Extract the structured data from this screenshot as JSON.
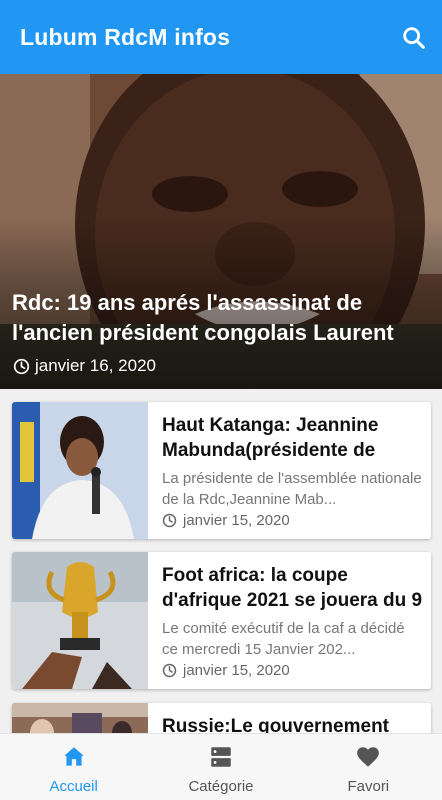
{
  "app": {
    "title": "Lubum RdcM infos",
    "accent_color": "#2196f3",
    "search_icon": "search-icon"
  },
  "featured": {
    "title": "Rdc: 19 ans aprés l'assassinat de l'ancien président congolais Laurent",
    "date": "janvier 16, 2020",
    "date_icon": "clock-icon"
  },
  "articles": [
    {
      "title": "Haut Katanga: Jeannine Mabunda(présidente de",
      "excerpt": "La présidente de l'assemblée nationale de la Rdc,Jeannine Mab...",
      "date": "janvier 15, 2020"
    },
    {
      "title": "Foot africa: la coupe d'afrique 2021 se jouera du 9",
      "excerpt": "Le comité exécutif de la caf a décidé ce mercredi 15 Janvier 202...",
      "date": "janvier 15, 2020"
    },
    {
      "title": "Russie:Le gouvernement"
    }
  ],
  "bottom_nav": [
    {
      "label": "Accueil",
      "icon": "home-icon",
      "active": true
    },
    {
      "label": "Catégorie",
      "icon": "category-icon",
      "active": false
    },
    {
      "label": "Favori",
      "icon": "heart-icon",
      "active": false
    }
  ]
}
